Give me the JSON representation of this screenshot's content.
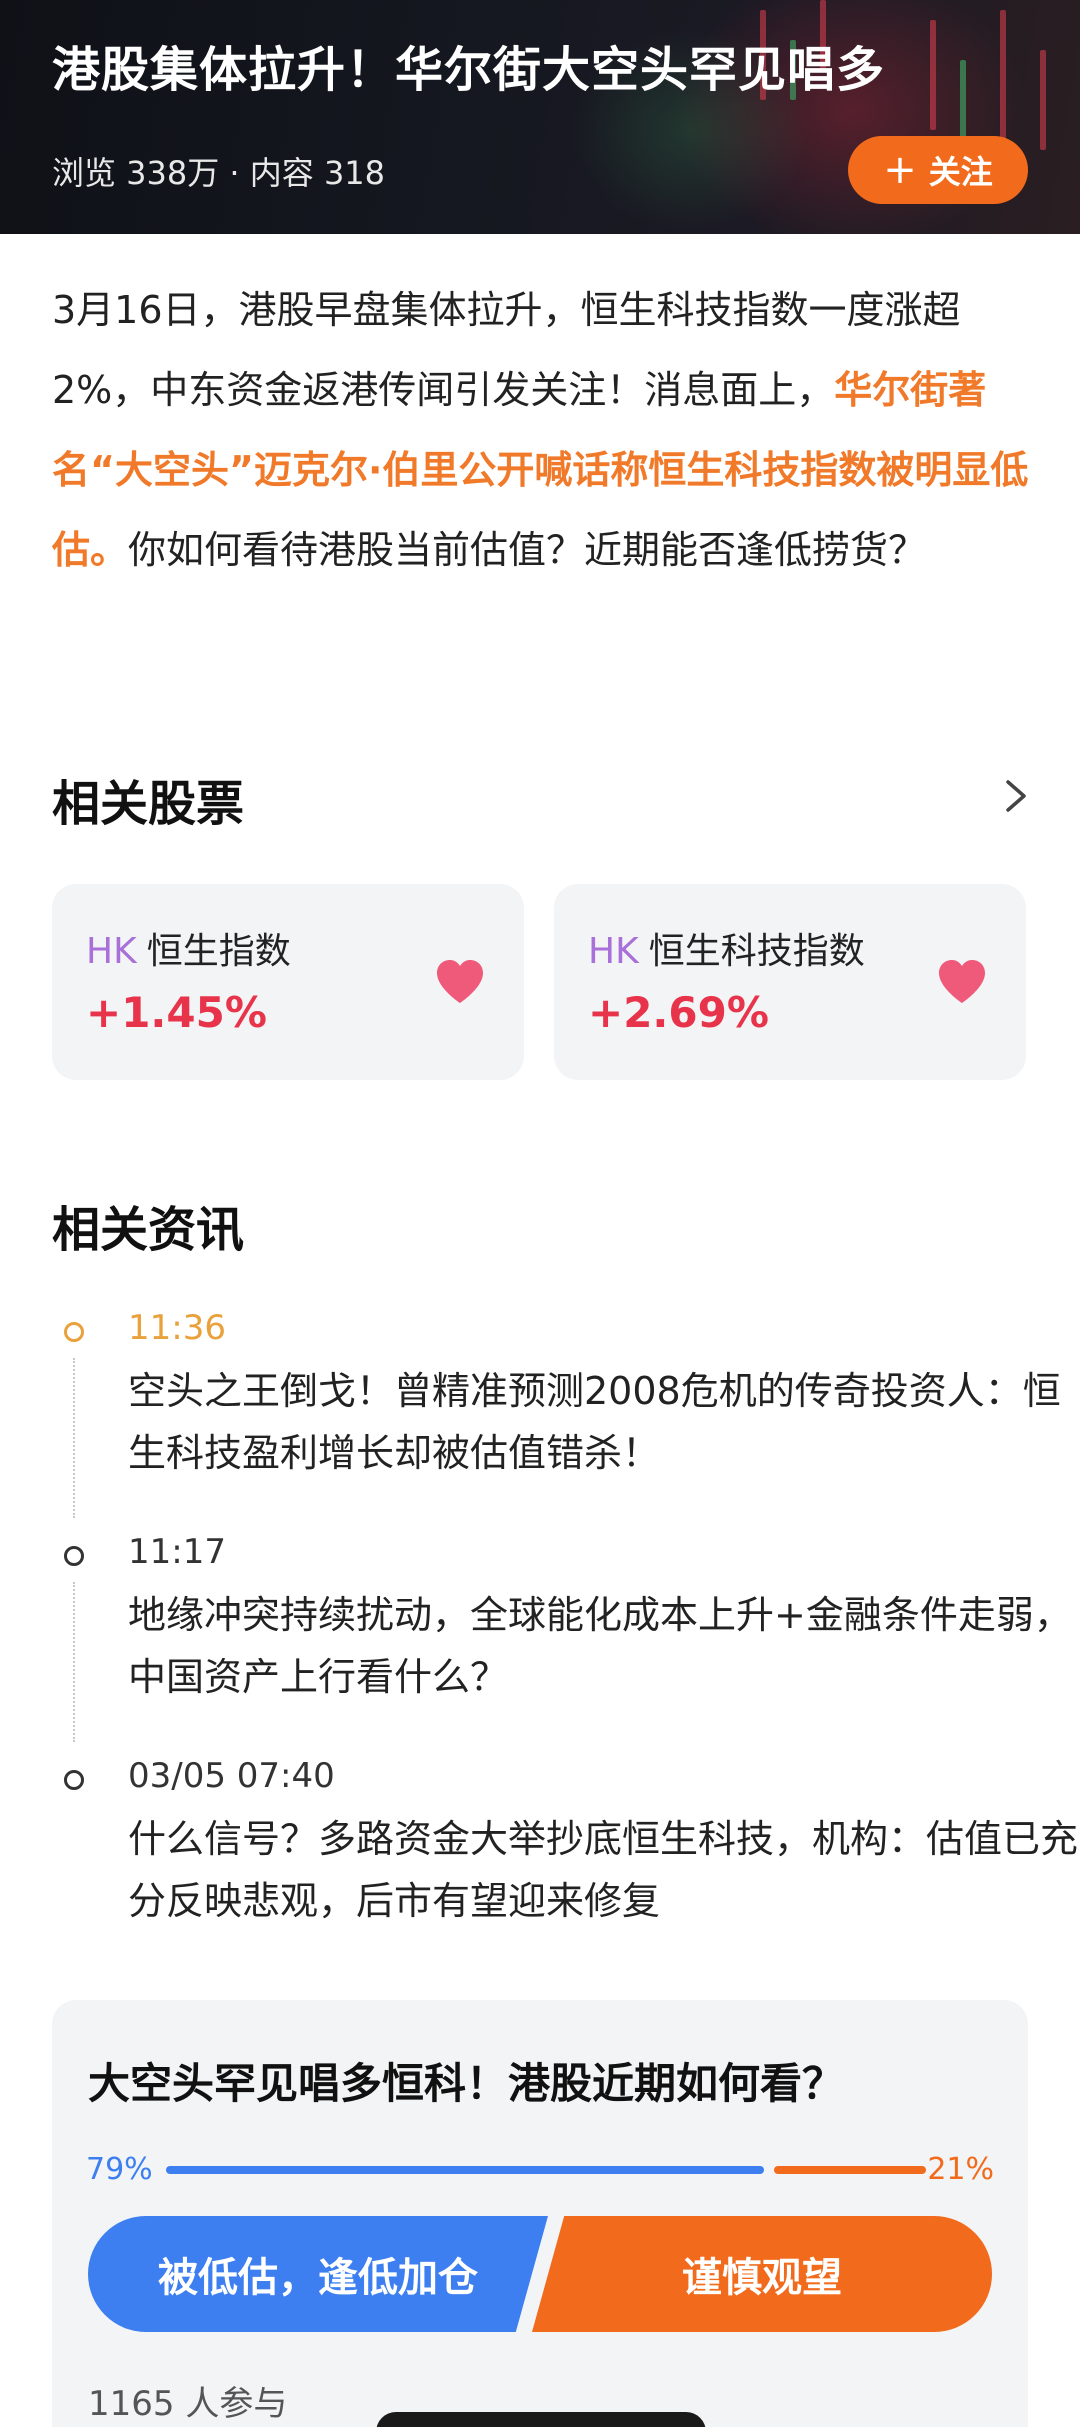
{
  "header": {
    "title": "港股集体拉升！华尔街大空头罕见唱多",
    "meta": "浏览 338万 · 内容 318",
    "follow_label": "关注",
    "follow_icon": "plus-icon"
  },
  "intro": {
    "part1": "3月16日，港股早盘集体拉升，恒生科技指数一度涨超2%，中东资金返港传闻引发关注！消息面上，",
    "highlight": "华尔街著名“大空头”迈克尔·伯里公开喊话称恒生科技指数被明显低估。",
    "part2": "你如何看待港股当前估值？近期能否逢低捞货？"
  },
  "related_stocks": {
    "title": "相关股票",
    "more_icon": "chevron-right-icon",
    "items": [
      {
        "market": "HK",
        "name": "恒生指数",
        "change": "+1.45%"
      },
      {
        "market": "HK",
        "name": "恒生科技指数",
        "change": "+2.69%"
      }
    ]
  },
  "related_news": {
    "title": "相关资讯",
    "items": [
      {
        "time": "11:36",
        "text": "空头之王倒戈！曾精准预测2008危机的传奇投资人：恒生科技盈利增长却被估值错杀！"
      },
      {
        "time": "11:17",
        "text": "地缘冲突持续扰动，全球能化成本上升+金融条件走弱，中国资产上行看什么？"
      },
      {
        "time": "03/05 07:40",
        "text": "什么信号？多路资金大举抄底恒生科技，机构：估值已充分反映悲观，后市有望迎来修复"
      }
    ]
  },
  "poll": {
    "title": "大空头罕见唱多恒科！港股近期如何看？",
    "left_pct": "79%",
    "right_pct": "21%",
    "left_option": "被低估，逢低加仓",
    "right_option": "谨慎观望",
    "participants": "1165 人参与"
  },
  "colors": {
    "accent_orange": "#f26a1b",
    "highlight_orange": "#f07a2a",
    "poll_blue": "#3d7ff0",
    "up_red": "#e8344a",
    "market_purple": "#a870d8",
    "timeline_active": "#e9a13b"
  }
}
